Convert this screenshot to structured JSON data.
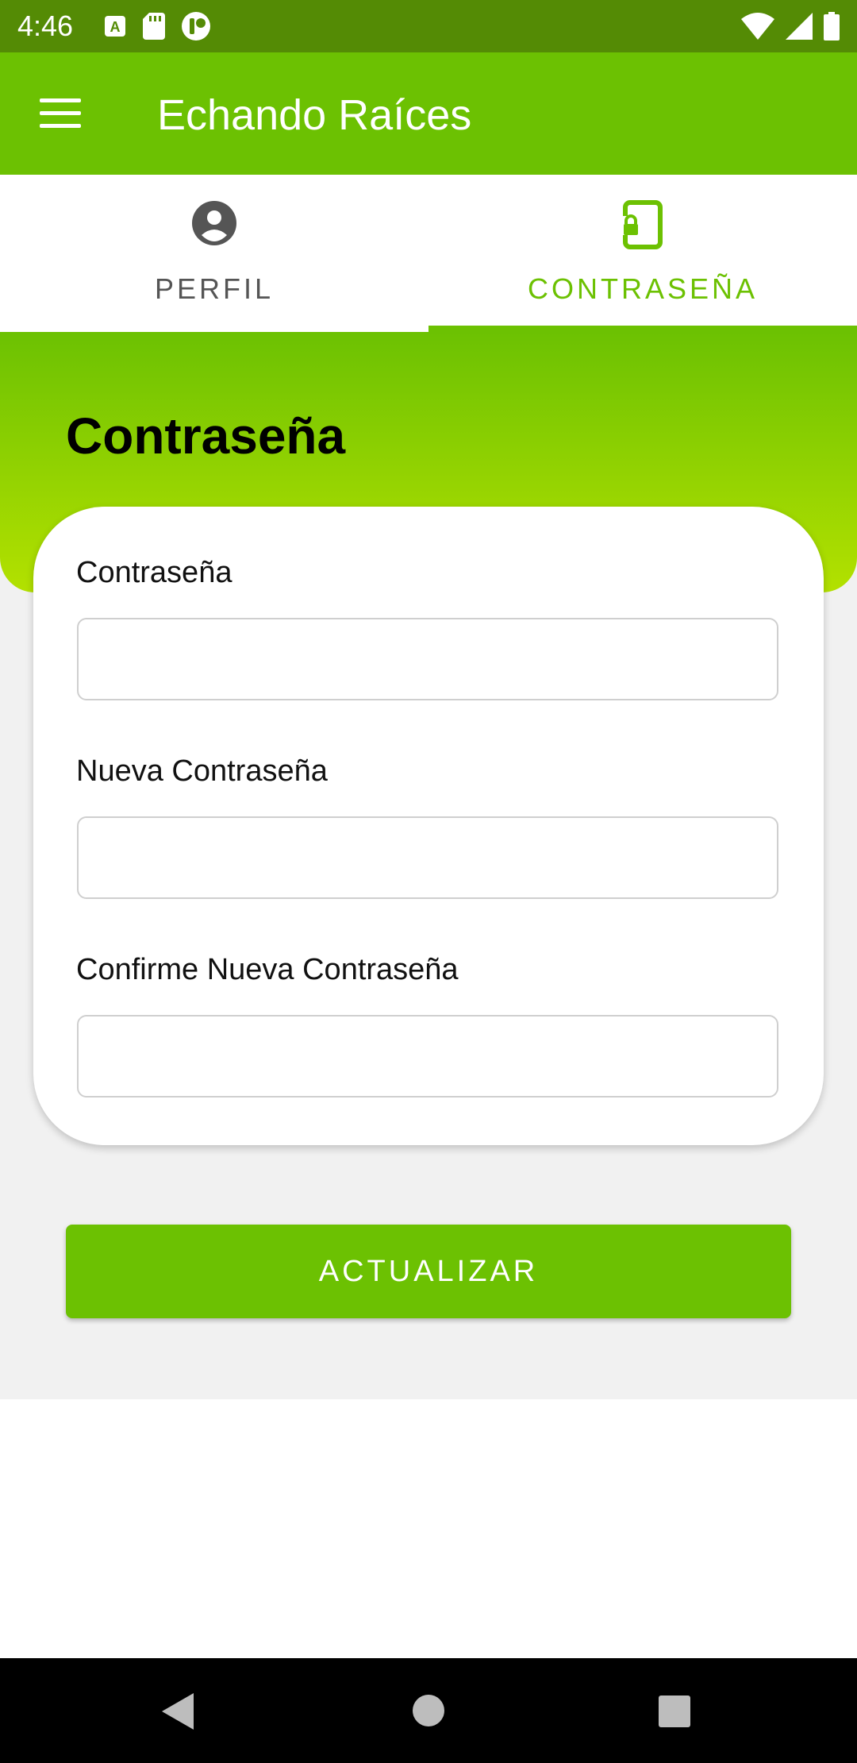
{
  "status_bar": {
    "time": "4:46",
    "icons_left": [
      "a-notification-icon",
      "sd-card-icon",
      "app-notification-icon"
    ],
    "icons_right": [
      "wifi-icon",
      "signal-icon",
      "battery-icon"
    ]
  },
  "app_bar": {
    "title": "Echando Raíces",
    "menu_icon": "menu-icon"
  },
  "tabs": [
    {
      "label": "PERFIL",
      "icon": "account-circle-icon",
      "active": false
    },
    {
      "label": "CONTRASEÑA",
      "icon": "phone-lock-icon",
      "active": true
    }
  ],
  "section": {
    "title": "Contraseña"
  },
  "form": {
    "fields": [
      {
        "label": "Contraseña",
        "value": "",
        "placeholder": ""
      },
      {
        "label": "Nueva Contraseña",
        "value": "",
        "placeholder": ""
      },
      {
        "label": "Confirme Nueva Contraseña",
        "value": "",
        "placeholder": ""
      }
    ],
    "submit_label": "ACTUALIZAR"
  },
  "colors": {
    "status_bar": "#548b05",
    "primary": "#6cc102",
    "gradient_end": "#b3e100",
    "inactive_tab": "#555555",
    "background": "#f1f1f1"
  },
  "nav_bar": {
    "icons": [
      "back-icon",
      "home-icon",
      "recents-icon"
    ]
  }
}
